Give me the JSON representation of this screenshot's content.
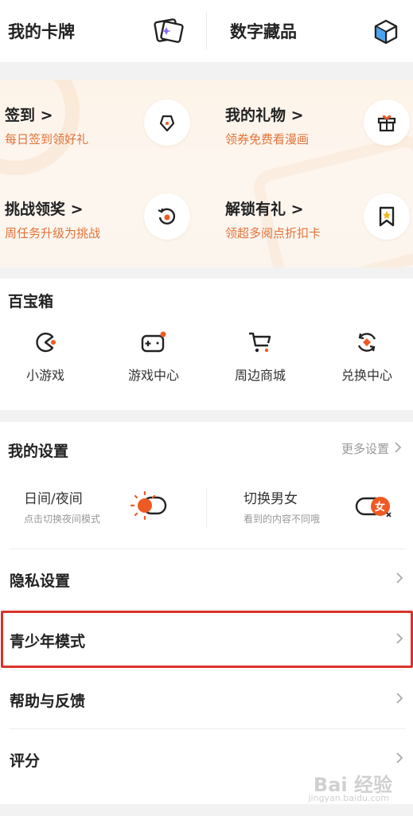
{
  "top_row": {
    "cards_label": "我的卡牌",
    "digital_label": "数字藏品"
  },
  "tasks": [
    {
      "title": "签到",
      "subtitle": "每日签到领好礼",
      "icon": "pen-icon"
    },
    {
      "title": "我的礼物",
      "subtitle": "领券免费看漫画",
      "icon": "gift-icon"
    },
    {
      "title": "挑战领奖",
      "subtitle": "周任务升级为挑战",
      "icon": "target-icon"
    },
    {
      "title": "解锁有礼",
      "subtitle": "领超多阅点折扣卡",
      "icon": "bookmark-star-icon"
    }
  ],
  "toolbox": {
    "title": "百宝箱",
    "items": [
      {
        "label": "小游戏",
        "icon": "pacman-icon"
      },
      {
        "label": "游戏中心",
        "icon": "gamepad-icon"
      },
      {
        "label": "周边商城",
        "icon": "cart-icon"
      },
      {
        "label": "兑换中心",
        "icon": "exchange-icon"
      }
    ]
  },
  "settings": {
    "title": "我的设置",
    "more": "更多设置",
    "day_night": {
      "title": "日间/夜间",
      "subtitle": "点击切换夜间模式"
    },
    "gender": {
      "title": "切换男女",
      "subtitle": "看到的内容不同哦",
      "toggle_text": "女"
    },
    "rows": [
      "隐私设置",
      "青少年模式",
      "帮助与反馈",
      "评分"
    ]
  },
  "watermark": {
    "text": "Bai 经验",
    "sub": "jingyan.baidu.com"
  },
  "colors": {
    "accent": "#ee5a24",
    "subtitle_orange": "#e0733a",
    "highlight": "#d9342b"
  }
}
